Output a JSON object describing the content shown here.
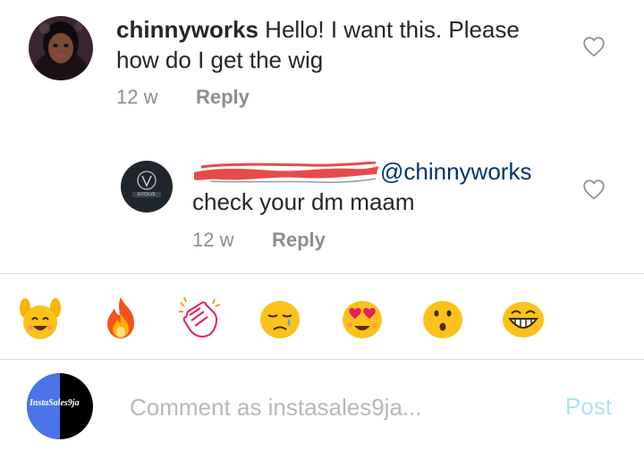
{
  "comment": {
    "username": "chinnyworks",
    "text": " Hello! I want this. Please how do I get the wig",
    "time": "12 w",
    "reply_label": "Reply"
  },
  "reply": {
    "mention": "@chinnyworks",
    "text": "check your dm maam",
    "time": "12 w",
    "reply_label": "Reply",
    "avatar_logo_text": "EVOLVE"
  },
  "emoji_bar": {
    "items": [
      "raising-hands-emoji",
      "fire-emoji",
      "clapping-hands-emoji",
      "crying-face-emoji",
      "heart-eyes-emoji",
      "surprised-face-emoji",
      "laughing-face-emoji"
    ]
  },
  "composer": {
    "placeholder": "Comment as instasales9ja...",
    "post_label": "Post",
    "avatar_brand": "InstaSales9ja",
    "post_color": "#b2dffc"
  },
  "colors": {
    "mention": "#003569",
    "muted": "#8e8e8e",
    "redaction": "#e84a4a"
  }
}
